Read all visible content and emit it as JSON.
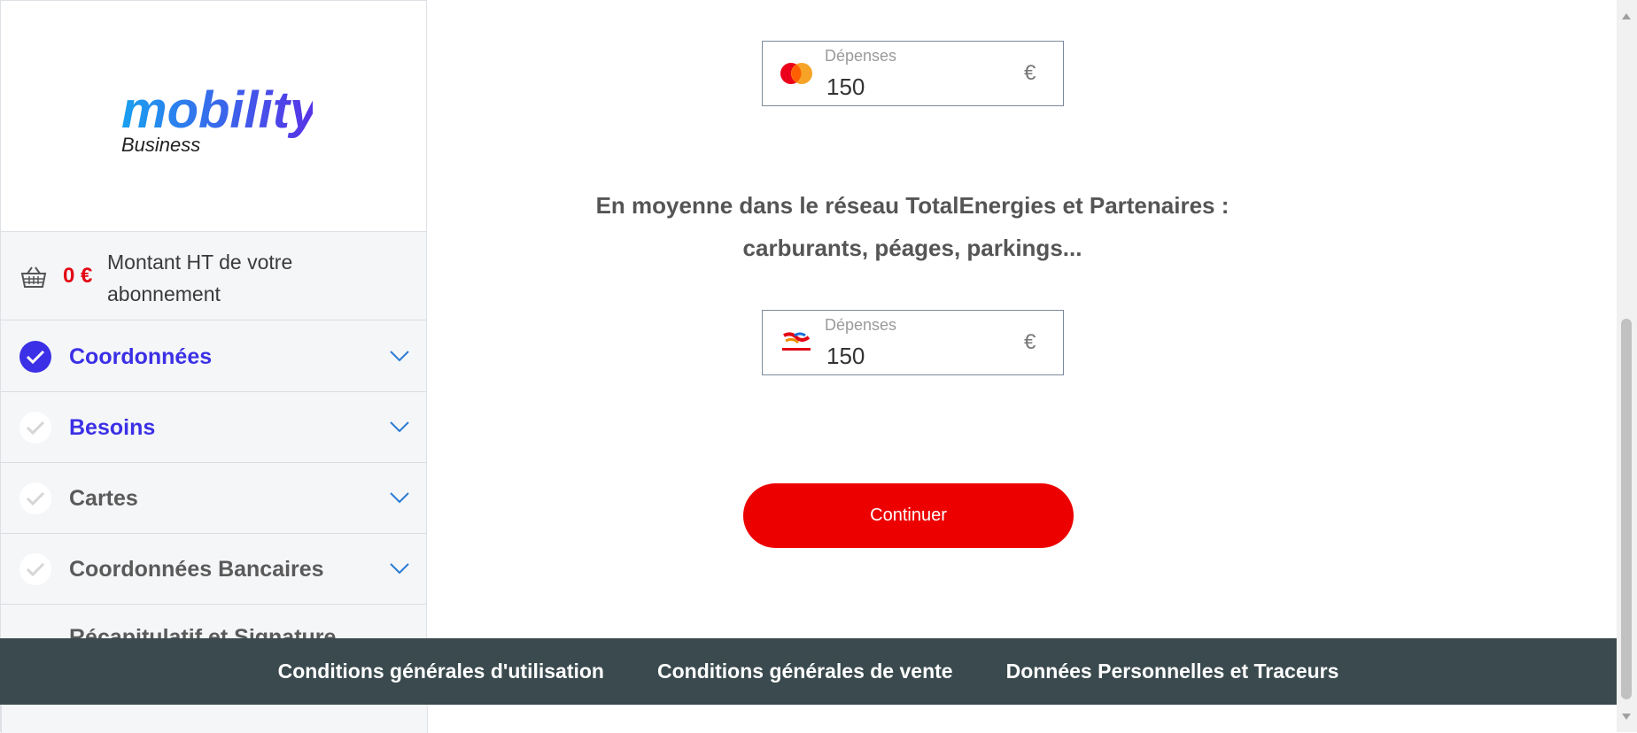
{
  "sidebar": {
    "logo": {
      "main": "mobility",
      "sub": "Business"
    },
    "summary": {
      "amount": "0 €",
      "label": "Montant HT de votre abonnement"
    },
    "steps": [
      {
        "label": "Coordonnées",
        "state": "done",
        "active": true
      },
      {
        "label": "Besoins",
        "state": "pending",
        "active": true
      },
      {
        "label": "Cartes",
        "state": "pending",
        "active": false
      },
      {
        "label": "Coordonnées Bancaires",
        "state": "pending",
        "active": false
      },
      {
        "label": "Récapitulatif et Signature",
        "state": "pending",
        "active": false
      }
    ]
  },
  "main": {
    "field1": {
      "label": "Dépenses",
      "value": "150",
      "currency": "€",
      "icon": "mastercard-icon"
    },
    "avg_text_line1": "En moyenne dans le réseau TotalEnergies et Partenaires :",
    "avg_text_line2": "carburants, péages, parkings...",
    "field2": {
      "label": "Dépenses",
      "value": "150",
      "currency": "€",
      "icon": "totalenergies-icon"
    },
    "continue_label": "Continuer"
  },
  "footer": {
    "links": [
      "Conditions générales d'utilisation",
      "Conditions générales de vente",
      "Données Personnelles et Traceurs"
    ]
  },
  "colors": {
    "brand_blue": "#3b30e6",
    "cta_red": "#ed0000",
    "footer_bg": "#3a4a4e"
  }
}
